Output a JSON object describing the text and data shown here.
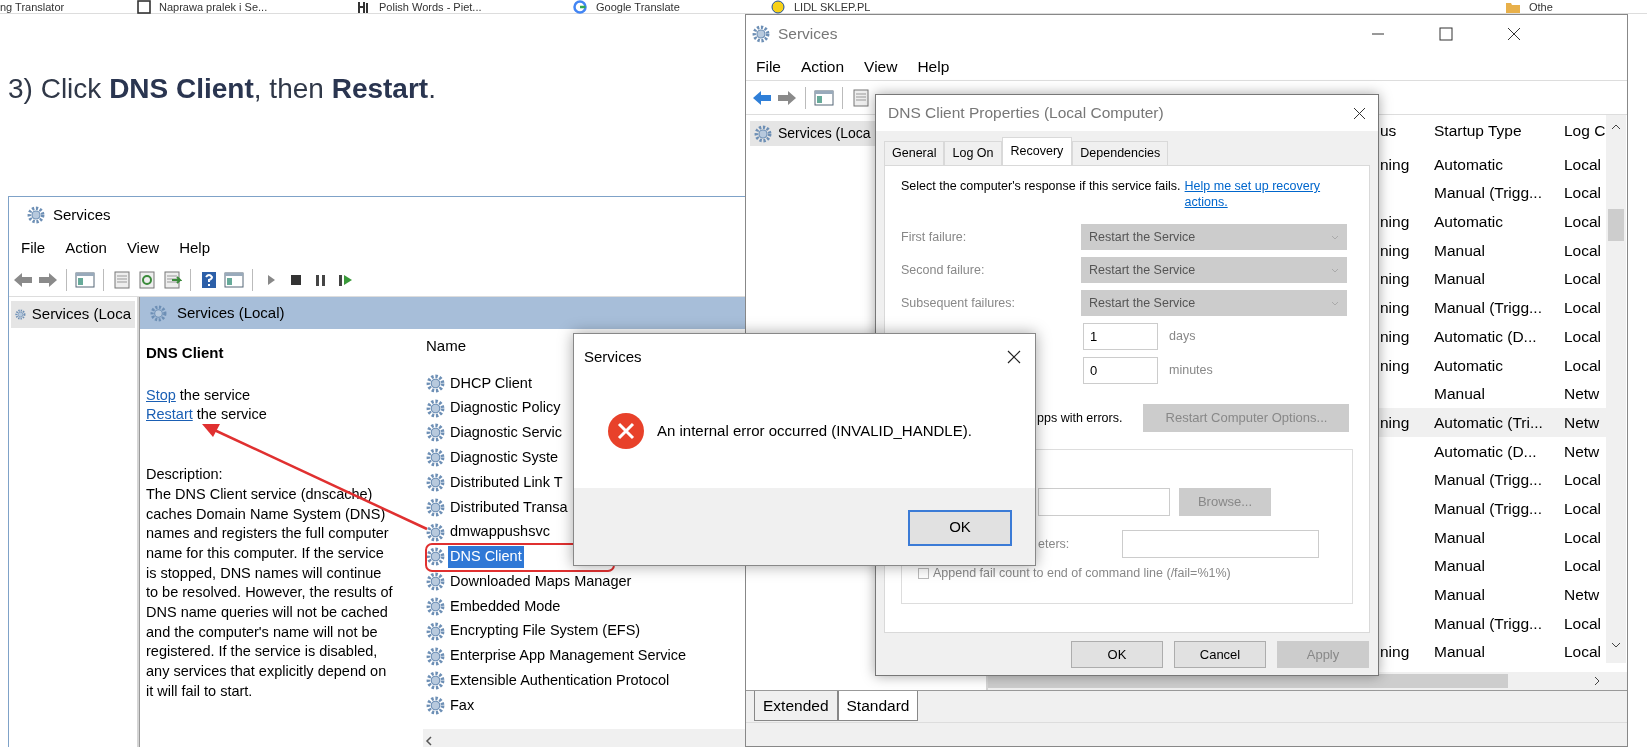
{
  "bookmarks": [
    {
      "label": "ng Translator"
    },
    {
      "label": "Naprawa pralek i Se..."
    },
    {
      "label": "Polish Words - Piet..."
    },
    {
      "label": "Google Translate"
    },
    {
      "label": "LIDL SKLEP.PL"
    },
    {
      "label": "Othe"
    }
  ],
  "article": {
    "step": "3) Click **DNS Client**, then **Restart**."
  },
  "screenshot": {
    "title": "Services",
    "menu": [
      "File",
      "Action",
      "View",
      "Help"
    ],
    "tree_item": "Services (Loca",
    "pane_header": "Services (Local)",
    "service_name": "DNS Client",
    "actions": [
      {
        "link": "Stop",
        "text": "the service"
      },
      {
        "link": "Restart",
        "text": "the service"
      }
    ],
    "description_label": "Description:",
    "description": "The DNS Client service (dnscache) caches Domain Name System (DNS) names and registers the full computer name for this computer. If the service is stopped, DNS names will continue to be resolved. However, the results of DNS name queries will not be cached and the computer's name will not be registered. If the service is disabled, any services that explicitly depend on it will fail to start.",
    "list_header": "Name",
    "services": [
      {
        "name": "DHCP Client",
        "selected": false
      },
      {
        "name": "Diagnostic Policy",
        "selected": false
      },
      {
        "name": "Diagnostic Servic",
        "selected": false
      },
      {
        "name": "Diagnostic Syste",
        "selected": false
      },
      {
        "name": "Distributed Link T",
        "selected": false
      },
      {
        "name": "Distributed Transa",
        "selected": false
      },
      {
        "name": "dmwappushsvc",
        "selected": false
      },
      {
        "name": "DNS Client",
        "selected": true
      },
      {
        "name": "Downloaded Maps Manager",
        "selected": false
      },
      {
        "name": "Embedded Mode",
        "selected": false
      },
      {
        "name": "Encrypting File System (EFS)",
        "selected": false
      },
      {
        "name": "Enterprise App Management Service",
        "selected": false
      },
      {
        "name": "Extensible Authentication Protocol",
        "selected": false
      },
      {
        "name": "Fax",
        "selected": false
      }
    ]
  },
  "services_window": {
    "title": "Services",
    "menu": [
      "File",
      "Action",
      "View",
      "Help"
    ],
    "tree_item": "Services (Loca",
    "columns": [
      "us",
      "Startup Type",
      "Log C"
    ],
    "rows": [
      {
        "status": "ning",
        "startup": "Automatic",
        "log_on": "Local",
        "selected": false
      },
      {
        "status": "",
        "startup": "Manual (Trigg...",
        "log_on": "Local",
        "selected": false
      },
      {
        "status": "ning",
        "startup": "Automatic",
        "log_on": "Local",
        "selected": false
      },
      {
        "status": "ning",
        "startup": "Manual",
        "log_on": "Local",
        "selected": false
      },
      {
        "status": "ning",
        "startup": "Manual",
        "log_on": "Local",
        "selected": false
      },
      {
        "status": "ning",
        "startup": "Manual (Trigg...",
        "log_on": "Local",
        "selected": false
      },
      {
        "status": "ning",
        "startup": "Automatic (D...",
        "log_on": "Local",
        "selected": false
      },
      {
        "status": "ning",
        "startup": "Automatic",
        "log_on": "Local",
        "selected": false
      },
      {
        "status": "",
        "startup": "Manual",
        "log_on": "Netw",
        "selected": false
      },
      {
        "status": "ning",
        "startup": "Automatic (Tri...",
        "log_on": "Netw",
        "selected": true
      },
      {
        "status": "",
        "startup": "Automatic (D...",
        "log_on": "Netw",
        "selected": false
      },
      {
        "status": "",
        "startup": "Manual (Trigg...",
        "log_on": "Local",
        "selected": false
      },
      {
        "status": "",
        "startup": "Manual (Trigg...",
        "log_on": "Local",
        "selected": false
      },
      {
        "status": "",
        "startup": "Manual",
        "log_on": "Local",
        "selected": false
      },
      {
        "status": "",
        "startup": "Manual",
        "log_on": "Local",
        "selected": false
      },
      {
        "status": "",
        "startup": "Manual",
        "log_on": "Netw",
        "selected": false
      },
      {
        "status": "",
        "startup": "Manual (Trigg...",
        "log_on": "Local",
        "selected": false
      },
      {
        "status": "ning",
        "startup": "Manual",
        "log_on": "Local",
        "selected": false
      }
    ],
    "view_tabs": [
      {
        "label": "Extended",
        "selected": false
      },
      {
        "label": "Standard",
        "selected": true
      }
    ]
  },
  "properties_dialog": {
    "title": "DNS Client Properties (Local Computer)",
    "tabs": [
      {
        "label": "General",
        "selected": false
      },
      {
        "label": "Log On",
        "selected": false
      },
      {
        "label": "Recovery",
        "selected": true
      },
      {
        "label": "Dependencies",
        "selected": false
      }
    ],
    "intro": "Select the computer's response if this service fails.",
    "help_link": "Help me set up recovery actions.",
    "failures": [
      {
        "label": "First failure:",
        "value": "Restart the Service",
        "disabled": true
      },
      {
        "label": "Second failure:",
        "value": "Restart the Service",
        "disabled": true
      },
      {
        "label": "Subsequent failures:",
        "value": "Restart the Service",
        "disabled": true
      }
    ],
    "counters": [
      {
        "value": "1",
        "unit": "days"
      },
      {
        "value": "0",
        "unit": "minutes"
      }
    ],
    "stops_label": "pps with errors.",
    "restart_options": {
      "label": "Restart Computer Options...",
      "disabled": true
    },
    "browse": {
      "label": "Browse...",
      "disabled": true
    },
    "params_label": "eters:",
    "append_fail": {
      "label": "Append fail count to end of command line (/fail=%1%)",
      "checked": false
    },
    "buttons": [
      {
        "label": "OK",
        "disabled": false
      },
      {
        "label": "Cancel",
        "disabled": false
      },
      {
        "label": "Apply",
        "disabled": true
      }
    ]
  },
  "error_dialog": {
    "title": "Services",
    "message": "An internal error occurred (INVALID_HANDLE).",
    "button": "OK"
  }
}
